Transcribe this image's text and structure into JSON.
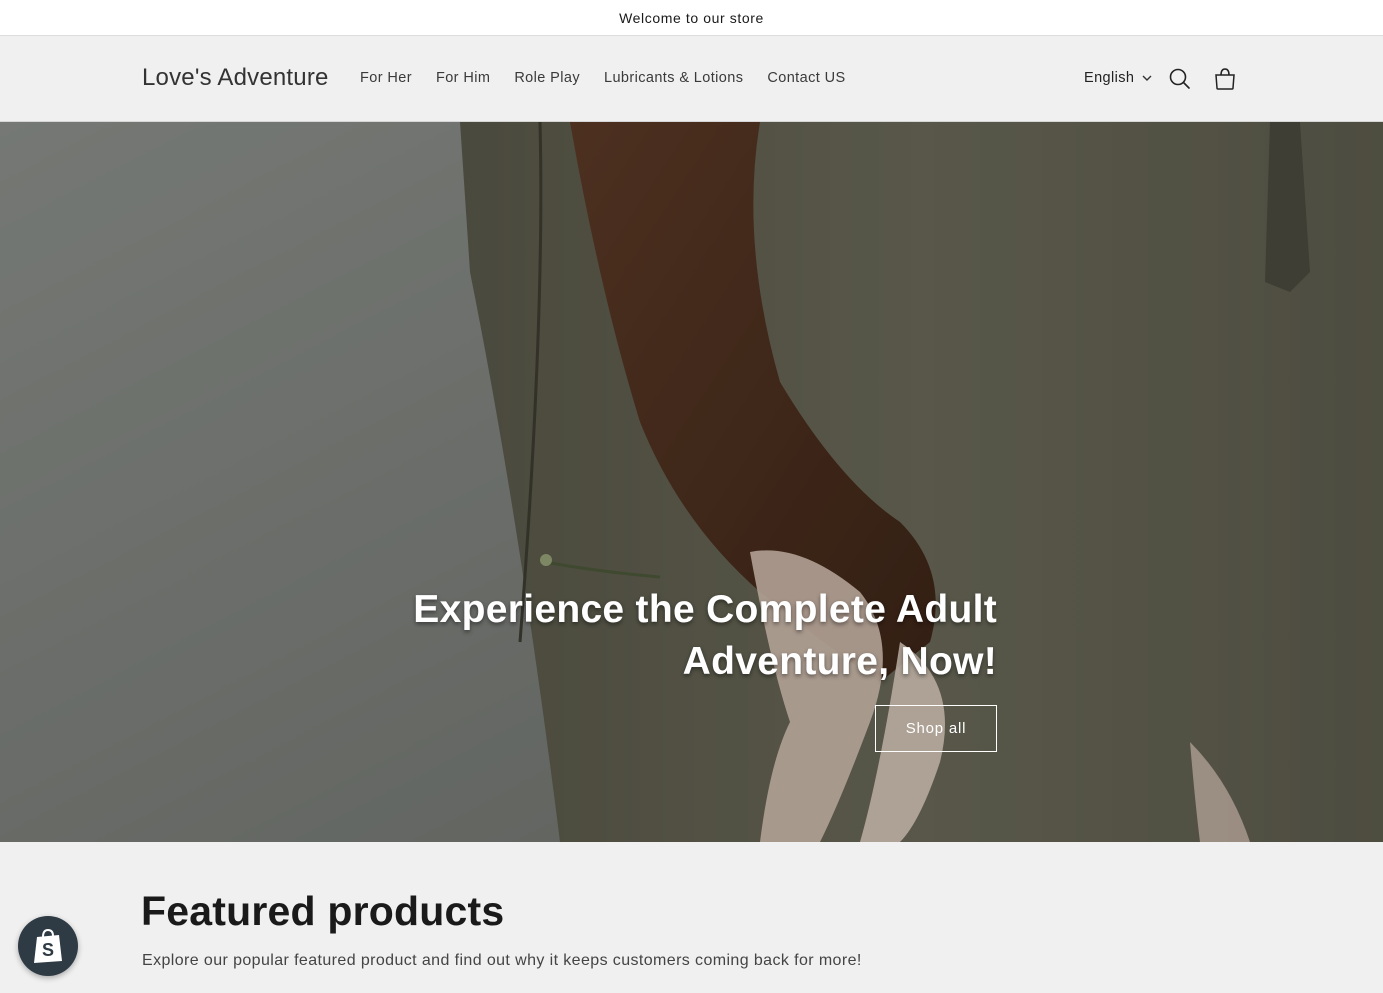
{
  "announcement": {
    "text": "Welcome to our store"
  },
  "header": {
    "logo": "Love's Adventure",
    "nav": [
      "For Her",
      "For Him",
      "Role Play",
      "Lubricants & Lotions",
      "Contact US"
    ],
    "language": "English",
    "icons": {
      "search": "search-icon",
      "cart": "cart-icon",
      "dropdown": "chevron-down-icon"
    }
  },
  "hero": {
    "title": "Experience the Complete Adult Adventure, Now!",
    "button": "Shop all"
  },
  "featured": {
    "title": "Featured products",
    "subtitle": "Explore our popular featured product and find out why it keeps customers coming back for more!"
  },
  "badge": {
    "icon": "shopify-bag-icon"
  },
  "colors": {
    "background": "#f0f0f0",
    "text": "#222222",
    "hero_text": "#ffffff"
  }
}
